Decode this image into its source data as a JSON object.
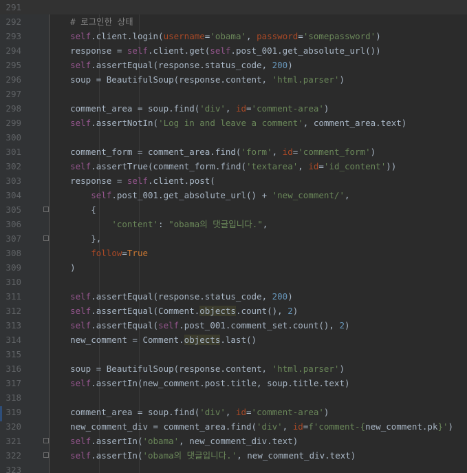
{
  "editor": {
    "lines": [
      {
        "n": "291",
        "cur": true,
        "t": []
      },
      {
        "n": "292",
        "t": [
          [
            "    # 로그인한 상태",
            "cmt"
          ]
        ]
      },
      {
        "n": "293",
        "t": [
          [
            "    ",
            ""
          ],
          [
            "self",
            "self"
          ],
          [
            ".client.login(",
            ""
          ],
          [
            "username",
            "param"
          ],
          [
            "=",
            ""
          ],
          [
            "'obama'",
            "str"
          ],
          [
            ", ",
            ""
          ],
          [
            "password",
            "param"
          ],
          [
            "=",
            ""
          ],
          [
            "'somepassword'",
            "str"
          ],
          [
            ")",
            ""
          ]
        ]
      },
      {
        "n": "294",
        "t": [
          [
            "    response = ",
            ""
          ],
          [
            "self",
            "self"
          ],
          [
            ".client.get(",
            ""
          ],
          [
            "self",
            "self"
          ],
          [
            ".post_001.get_absolute_url())",
            ""
          ]
        ]
      },
      {
        "n": "295",
        "t": [
          [
            "    ",
            ""
          ],
          [
            "self",
            "self"
          ],
          [
            ".assertEqual(response.status_code, ",
            ""
          ],
          [
            "200",
            "num-lit"
          ],
          [
            ")",
            ""
          ]
        ]
      },
      {
        "n": "296",
        "t": [
          [
            "    soup = BeautifulSoup(response.content, ",
            ""
          ],
          [
            "'html.parser'",
            "str"
          ],
          [
            ")",
            ""
          ]
        ]
      },
      {
        "n": "297",
        "t": []
      },
      {
        "n": "298",
        "t": [
          [
            "    comment_area = soup.find(",
            ""
          ],
          [
            "'div'",
            "str"
          ],
          [
            ", ",
            ""
          ],
          [
            "id",
            "param"
          ],
          [
            "=",
            ""
          ],
          [
            "'comment-area'",
            "str"
          ],
          [
            ")",
            ""
          ]
        ]
      },
      {
        "n": "299",
        "t": [
          [
            "    ",
            ""
          ],
          [
            "self",
            "self"
          ],
          [
            ".assertNotIn(",
            ""
          ],
          [
            "'Log in and leave a comment'",
            "str"
          ],
          [
            ", comment_area.text)",
            ""
          ]
        ]
      },
      {
        "n": "300",
        "t": []
      },
      {
        "n": "301",
        "t": [
          [
            "    comment_form = comment_area.find(",
            ""
          ],
          [
            "'form'",
            "str"
          ],
          [
            ", ",
            ""
          ],
          [
            "id",
            "param"
          ],
          [
            "=",
            ""
          ],
          [
            "'comment_form'",
            "str"
          ],
          [
            ")",
            ""
          ]
        ]
      },
      {
        "n": "302",
        "t": [
          [
            "    ",
            ""
          ],
          [
            "self",
            "self"
          ],
          [
            ".assertTrue(comment_form.find(",
            ""
          ],
          [
            "'textarea'",
            "str"
          ],
          [
            ", ",
            ""
          ],
          [
            "id",
            "param"
          ],
          [
            "=",
            ""
          ],
          [
            "'id_content'",
            "str"
          ],
          [
            "))",
            ""
          ]
        ]
      },
      {
        "n": "303",
        "t": [
          [
            "    response = ",
            ""
          ],
          [
            "self",
            "self"
          ],
          [
            ".client.post(",
            ""
          ]
        ]
      },
      {
        "n": "304",
        "t": [
          [
            "        ",
            ""
          ],
          [
            "self",
            "self"
          ],
          [
            ".post_001.get_absolute_url() + ",
            ""
          ],
          [
            "'new_comment/'",
            "str"
          ],
          [
            ",",
            ""
          ]
        ]
      },
      {
        "n": "305",
        "fold": true,
        "t": [
          [
            "        {",
            ""
          ]
        ]
      },
      {
        "n": "306",
        "t": [
          [
            "            ",
            ""
          ],
          [
            "'content'",
            "str"
          ],
          [
            ": ",
            ""
          ],
          [
            "\"obama의 댓글입니다.\"",
            "str"
          ],
          [
            ",",
            ""
          ]
        ]
      },
      {
        "n": "307",
        "fold": true,
        "t": [
          [
            "        },",
            ""
          ]
        ]
      },
      {
        "n": "308",
        "t": [
          [
            "        ",
            ""
          ],
          [
            "follow",
            "param"
          ],
          [
            "=",
            ""
          ],
          [
            "True",
            "kw"
          ]
        ]
      },
      {
        "n": "309",
        "t": [
          [
            "    )",
            ""
          ]
        ]
      },
      {
        "n": "310",
        "t": []
      },
      {
        "n": "311",
        "t": [
          [
            "    ",
            ""
          ],
          [
            "self",
            "self"
          ],
          [
            ".assertEqual(response.status_code, ",
            ""
          ],
          [
            "200",
            "num-lit"
          ],
          [
            ")",
            ""
          ]
        ]
      },
      {
        "n": "312",
        "t": [
          [
            "    ",
            ""
          ],
          [
            "self",
            "self"
          ],
          [
            ".assertEqual(Comment.",
            ""
          ],
          [
            "objects",
            "hl"
          ],
          [
            ".count(), ",
            ""
          ],
          [
            "2",
            "num-lit"
          ],
          [
            ")",
            ""
          ]
        ]
      },
      {
        "n": "313",
        "t": [
          [
            "    ",
            ""
          ],
          [
            "self",
            "self"
          ],
          [
            ".assertEqual(",
            ""
          ],
          [
            "self",
            "self"
          ],
          [
            ".post_001.comment_set.count(), ",
            ""
          ],
          [
            "2",
            "num-lit"
          ],
          [
            ")",
            ""
          ]
        ]
      },
      {
        "n": "314",
        "t": [
          [
            "    new_comment = Comment.",
            ""
          ],
          [
            "objects",
            "hl"
          ],
          [
            ".last()",
            ""
          ]
        ]
      },
      {
        "n": "315",
        "t": []
      },
      {
        "n": "316",
        "t": [
          [
            "    soup = BeautifulSoup(response.content, ",
            ""
          ],
          [
            "'html.parser'",
            "str"
          ],
          [
            ")",
            ""
          ]
        ]
      },
      {
        "n": "317",
        "t": [
          [
            "    ",
            ""
          ],
          [
            "self",
            "self"
          ],
          [
            ".assertIn(new_comment.post.title, soup.title.text)",
            ""
          ]
        ]
      },
      {
        "n": "318",
        "t": []
      },
      {
        "n": "319",
        "t": [
          [
            "    comment_area = soup.find(",
            ""
          ],
          [
            "'div'",
            "str"
          ],
          [
            ", ",
            ""
          ],
          [
            "id",
            "param"
          ],
          [
            "=",
            ""
          ],
          [
            "'comment-area'",
            "str"
          ],
          [
            ")",
            ""
          ]
        ]
      },
      {
        "n": "320",
        "t": [
          [
            "    new_comment_div = comment_area.find(",
            ""
          ],
          [
            "'div'",
            "str"
          ],
          [
            ", ",
            ""
          ],
          [
            "id",
            "param"
          ],
          [
            "=",
            ""
          ],
          [
            "f'comment-{",
            "str"
          ],
          [
            "new_comment.pk",
            ""
          ],
          [
            "}'",
            "str"
          ],
          [
            ")",
            ""
          ]
        ]
      },
      {
        "n": "321",
        "fold": true,
        "t": [
          [
            "    ",
            ""
          ],
          [
            "self",
            "self"
          ],
          [
            ".assertIn(",
            ""
          ],
          [
            "'obama'",
            "str"
          ],
          [
            ", new_comment_div.text)",
            ""
          ]
        ]
      },
      {
        "n": "322",
        "fold": true,
        "t": [
          [
            "    ",
            ""
          ],
          [
            "self",
            "self"
          ],
          [
            ".assertIn(",
            ""
          ],
          [
            "'obama의 댓글입니다.'",
            "str"
          ],
          [
            ", new_comment_div.text)",
            ""
          ]
        ]
      },
      {
        "n": "323",
        "t": []
      }
    ]
  }
}
